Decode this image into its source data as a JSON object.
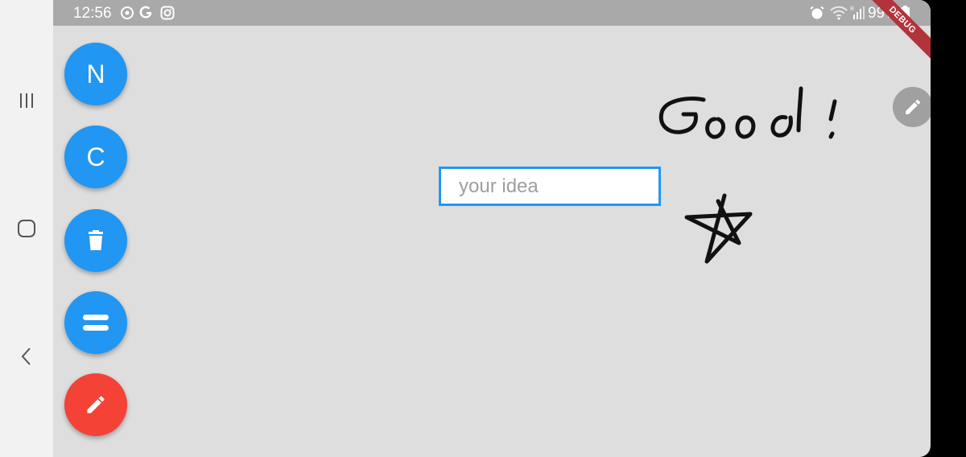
{
  "status_bar": {
    "time": "12:56",
    "battery": "99%"
  },
  "debug_banner": "DEBUG",
  "fabs": [
    {
      "label": "N",
      "icon": "letter-n"
    },
    {
      "label": "C",
      "icon": "letter-c"
    },
    {
      "label": "",
      "icon": "trash-icon"
    },
    {
      "label": "",
      "icon": "menu-equals-icon"
    },
    {
      "label": "",
      "icon": "pencil-icon"
    }
  ],
  "idea_input": {
    "placeholder": "your idea",
    "value": ""
  },
  "colors": {
    "fab_blue": "#2196f3",
    "fab_red": "#f44336",
    "canvas_bg": "#dedede",
    "status_bar_bg": "#a9a9a9"
  }
}
